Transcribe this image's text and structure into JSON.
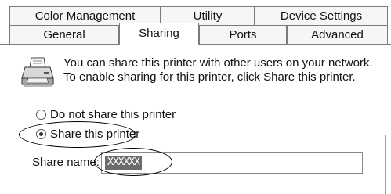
{
  "tabs": {
    "back_row": [
      "Color Management",
      "Utility",
      "Device Settings"
    ],
    "front_row": [
      "General",
      "Sharing",
      "Ports",
      "Advanced"
    ],
    "selected": "Sharing"
  },
  "info_text": "You can share this printer with other users on your network.  To enable sharing for this printer, click Share this printer.",
  "options": {
    "do_not_share": "Do not share this printer",
    "share": "Share this printer",
    "selected": "share"
  },
  "share_name": {
    "label": "Share name:",
    "value": "XXXXXX"
  },
  "icons": {
    "printer": "printer-icon"
  }
}
